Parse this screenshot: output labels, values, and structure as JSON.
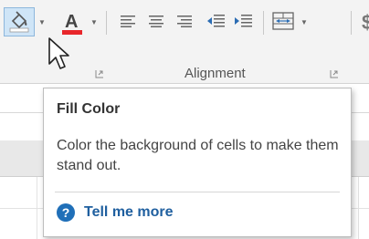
{
  "ribbon": {
    "group_label": "Alignment",
    "dollar_glyph": "$",
    "icons": {
      "fill": "paint-bucket-icon",
      "font_color": "font-color-icon",
      "font_color_swatch": "#e8262b",
      "fill_swatch": "#ffffff"
    }
  },
  "tooltip": {
    "title": "Fill Color",
    "description": "Color the background of cells to make them stand out.",
    "help_label": "Tell me more",
    "help_icon": "?"
  }
}
